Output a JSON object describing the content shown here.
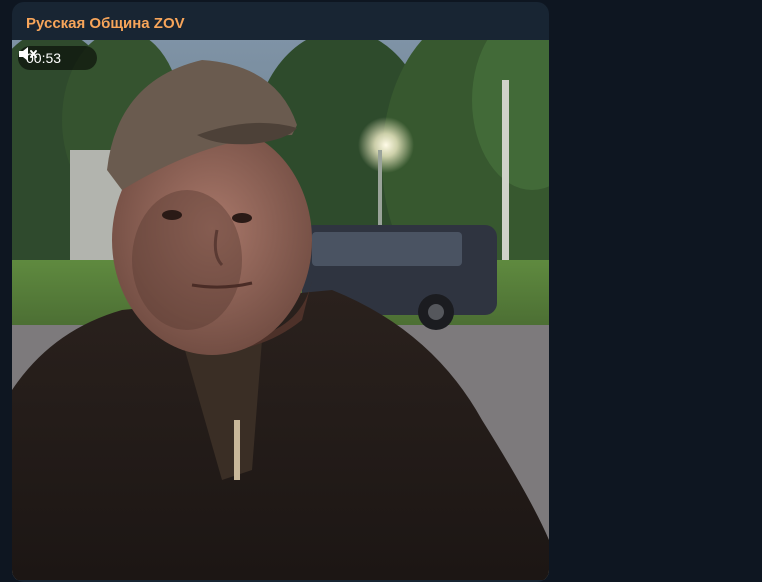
{
  "message": {
    "channel_name": "Русская Община ZOV",
    "channel_name_color": "#f7a55a"
  },
  "video": {
    "duration": "00:53",
    "muted": true,
    "mute_icon": "speaker-muted-icon"
  },
  "theme": {
    "chat_background": "#0e1621",
    "bubble_background": "#182533"
  }
}
